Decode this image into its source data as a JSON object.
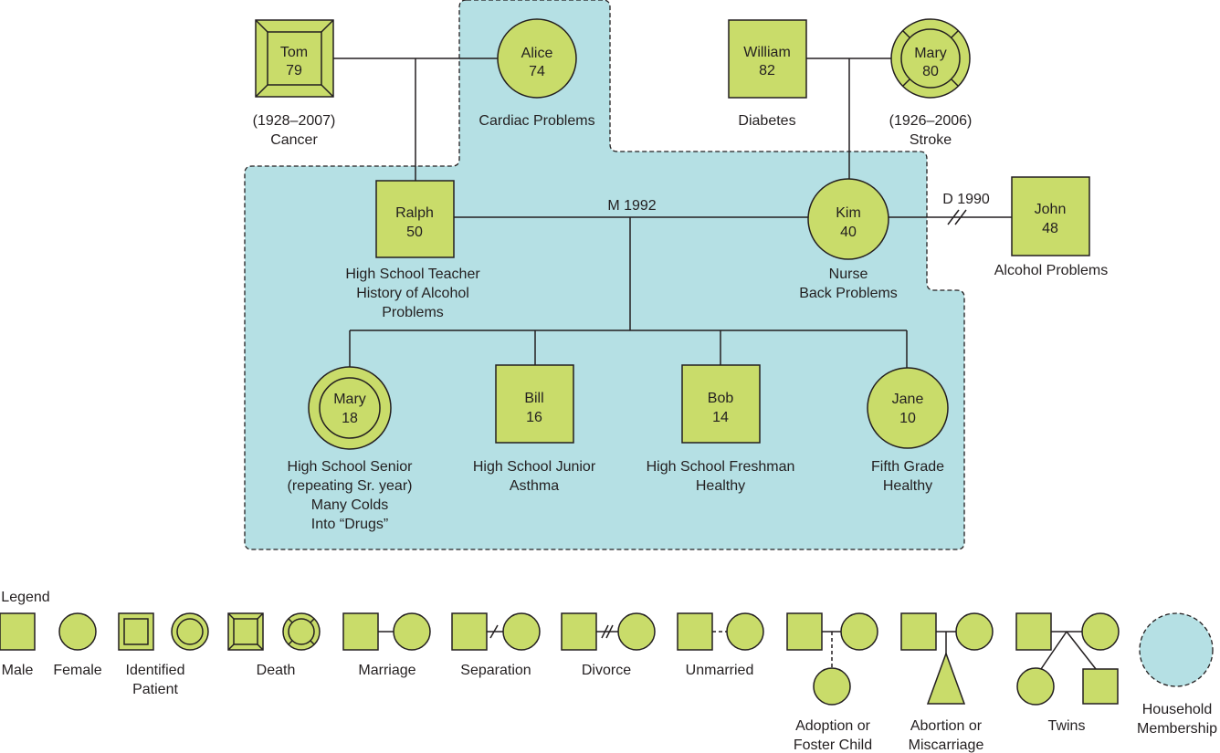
{
  "colors": {
    "symbol_fill": "#c9dc6a",
    "household_fill": "#b5e0e4",
    "line": "#231f20"
  },
  "people": {
    "tom": {
      "name": "Tom",
      "age": "79",
      "notes": [
        "(1928–2007)",
        "Cancer"
      ],
      "symbol": "male-deceased"
    },
    "alice": {
      "name": "Alice",
      "age": "74",
      "notes": [
        "Cardiac Problems"
      ],
      "symbol": "female"
    },
    "william": {
      "name": "William",
      "age": "82",
      "notes": [
        "Diabetes"
      ],
      "symbol": "male"
    },
    "mary_gm": {
      "name": "Mary",
      "age": "80",
      "notes": [
        "(1926–2006)",
        "Stroke"
      ],
      "symbol": "female-deceased"
    },
    "ralph": {
      "name": "Ralph",
      "age": "50",
      "notes": [
        "High School Teacher",
        "History of Alcohol",
        "Problems"
      ],
      "symbol": "male"
    },
    "kim": {
      "name": "Kim",
      "age": "40",
      "notes": [
        "Nurse",
        "Back Problems"
      ],
      "symbol": "female"
    },
    "john": {
      "name": "John",
      "age": "48",
      "notes": [
        "Alcohol Problems"
      ],
      "symbol": "male"
    },
    "mary": {
      "name": "Mary",
      "age": "18",
      "notes": [
        "High School Senior",
        "(repeating Sr. year)",
        "Many Colds",
        "Into “Drugs”"
      ],
      "symbol": "female-identified-patient"
    },
    "bill": {
      "name": "Bill",
      "age": "16",
      "notes": [
        "High School Junior",
        "Asthma"
      ],
      "symbol": "male"
    },
    "bob": {
      "name": "Bob",
      "age": "14",
      "notes": [
        "High School Freshman",
        "Healthy"
      ],
      "symbol": "male"
    },
    "jane": {
      "name": "Jane",
      "age": "10",
      "notes": [
        "Fifth Grade",
        "Healthy"
      ],
      "symbol": "female"
    }
  },
  "relations": {
    "marriage": "M 1992",
    "divorce": "D 1990"
  },
  "legend": {
    "title": "Legend",
    "items": {
      "male": [
        "Male"
      ],
      "female": [
        "Female"
      ],
      "identified": [
        "Identified",
        "Patient"
      ],
      "death": [
        "Death"
      ],
      "marriage": [
        "Marriage"
      ],
      "separation": [
        "Separation"
      ],
      "divorce": [
        "Divorce"
      ],
      "unmarried": [
        "Unmarried"
      ],
      "adoption": [
        "Adoption or",
        "Foster Child"
      ],
      "abortion": [
        "Abortion or",
        "Miscarriage"
      ],
      "twins": [
        "Twins"
      ],
      "household": [
        "Household",
        "Membership"
      ]
    }
  }
}
